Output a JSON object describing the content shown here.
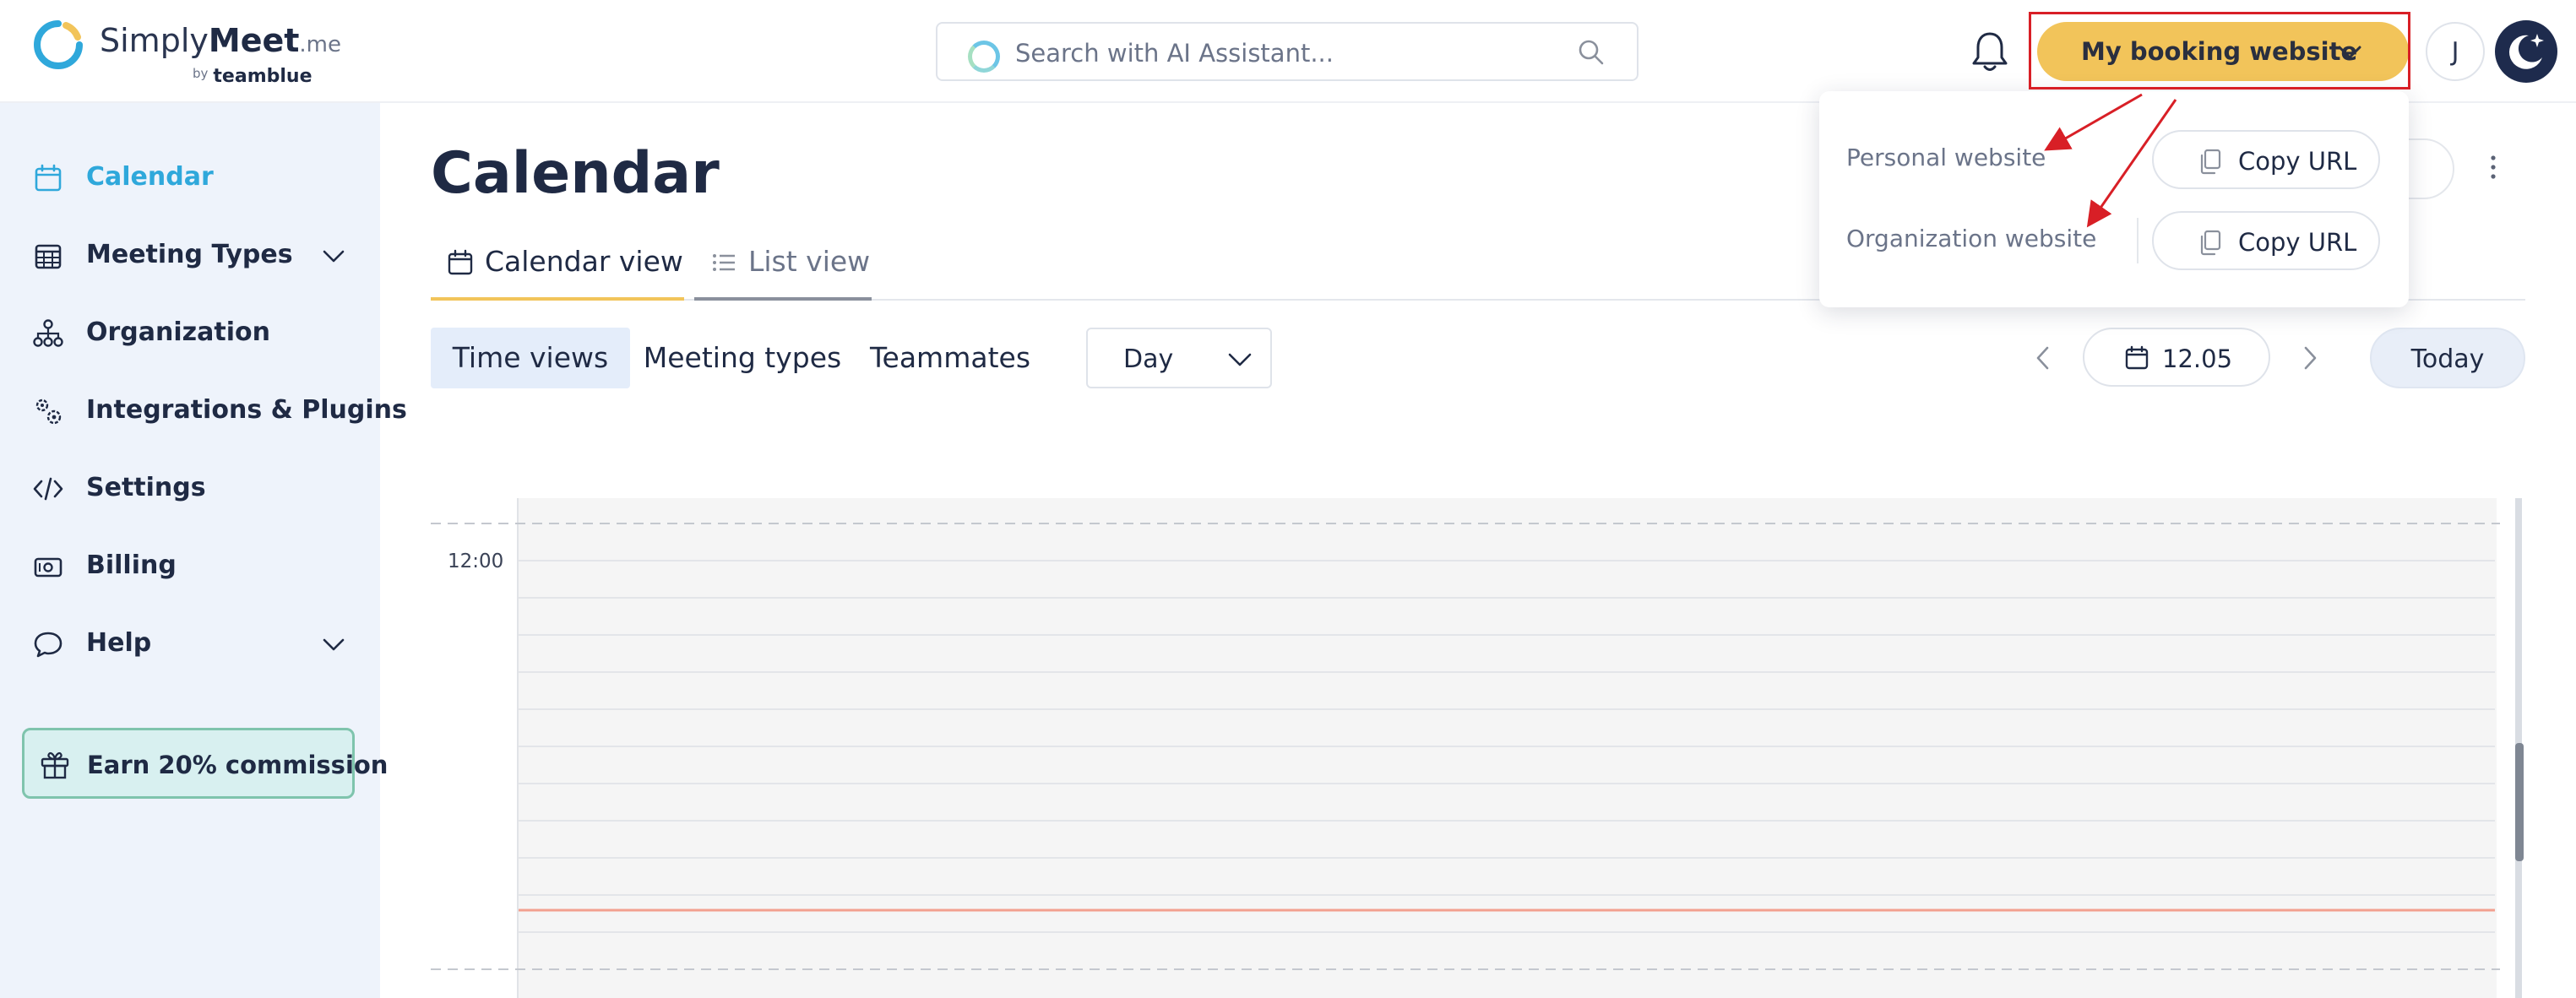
{
  "header": {
    "logo": {
      "name_light": "Simply",
      "name_bold": "Meet",
      "tld": ".me",
      "by": "by",
      "company": "teamblue"
    },
    "search": {
      "placeholder": "Search with AI Assistant..."
    },
    "booking_button": {
      "label": "My booking website"
    },
    "avatar": {
      "initial": "J"
    }
  },
  "sidebar": {
    "items": [
      {
        "label": "Calendar",
        "icon": "calendar-icon",
        "active": true
      },
      {
        "label": "Meeting Types",
        "icon": "grid-calendar-icon",
        "expandable": true
      },
      {
        "label": "Organization",
        "icon": "org-chart-icon"
      },
      {
        "label": "Integrations & Plugins",
        "icon": "gears-icon"
      },
      {
        "label": "Settings",
        "icon": "code-icon"
      },
      {
        "label": "Billing",
        "icon": "banknote-icon"
      },
      {
        "label": "Help",
        "icon": "chat-bubble-icon",
        "expandable": true
      }
    ],
    "promo": {
      "label": "Earn 20% commission",
      "icon": "gift-icon"
    }
  },
  "main": {
    "title": "Calendar",
    "view_tabs": [
      {
        "label": "Calendar view",
        "icon": "calendar-icon",
        "active": true
      },
      {
        "label": "List view",
        "icon": "list-icon",
        "active": false
      }
    ],
    "segments": [
      {
        "label": "Time views",
        "active": true
      },
      {
        "label": "Meeting types",
        "active": false
      },
      {
        "label": "Teammates",
        "active": false
      }
    ],
    "view_select": {
      "value": "Day"
    },
    "date_nav": {
      "date": "12.05",
      "today_label": "Today"
    },
    "grid": {
      "time_label": "12:00"
    }
  },
  "booking_dropdown": {
    "rows": [
      {
        "label": "Personal website",
        "action": "Copy URL"
      },
      {
        "label": "Organization website",
        "action": "Copy URL"
      }
    ]
  },
  "colors": {
    "accent": "#2fa8db",
    "booking_button": "#f2c45a",
    "sidebar_bg": "#eef3fb",
    "annotation": "#d81f26",
    "current_time_line": "#f2a08f",
    "navy": "#1e2b4d"
  }
}
